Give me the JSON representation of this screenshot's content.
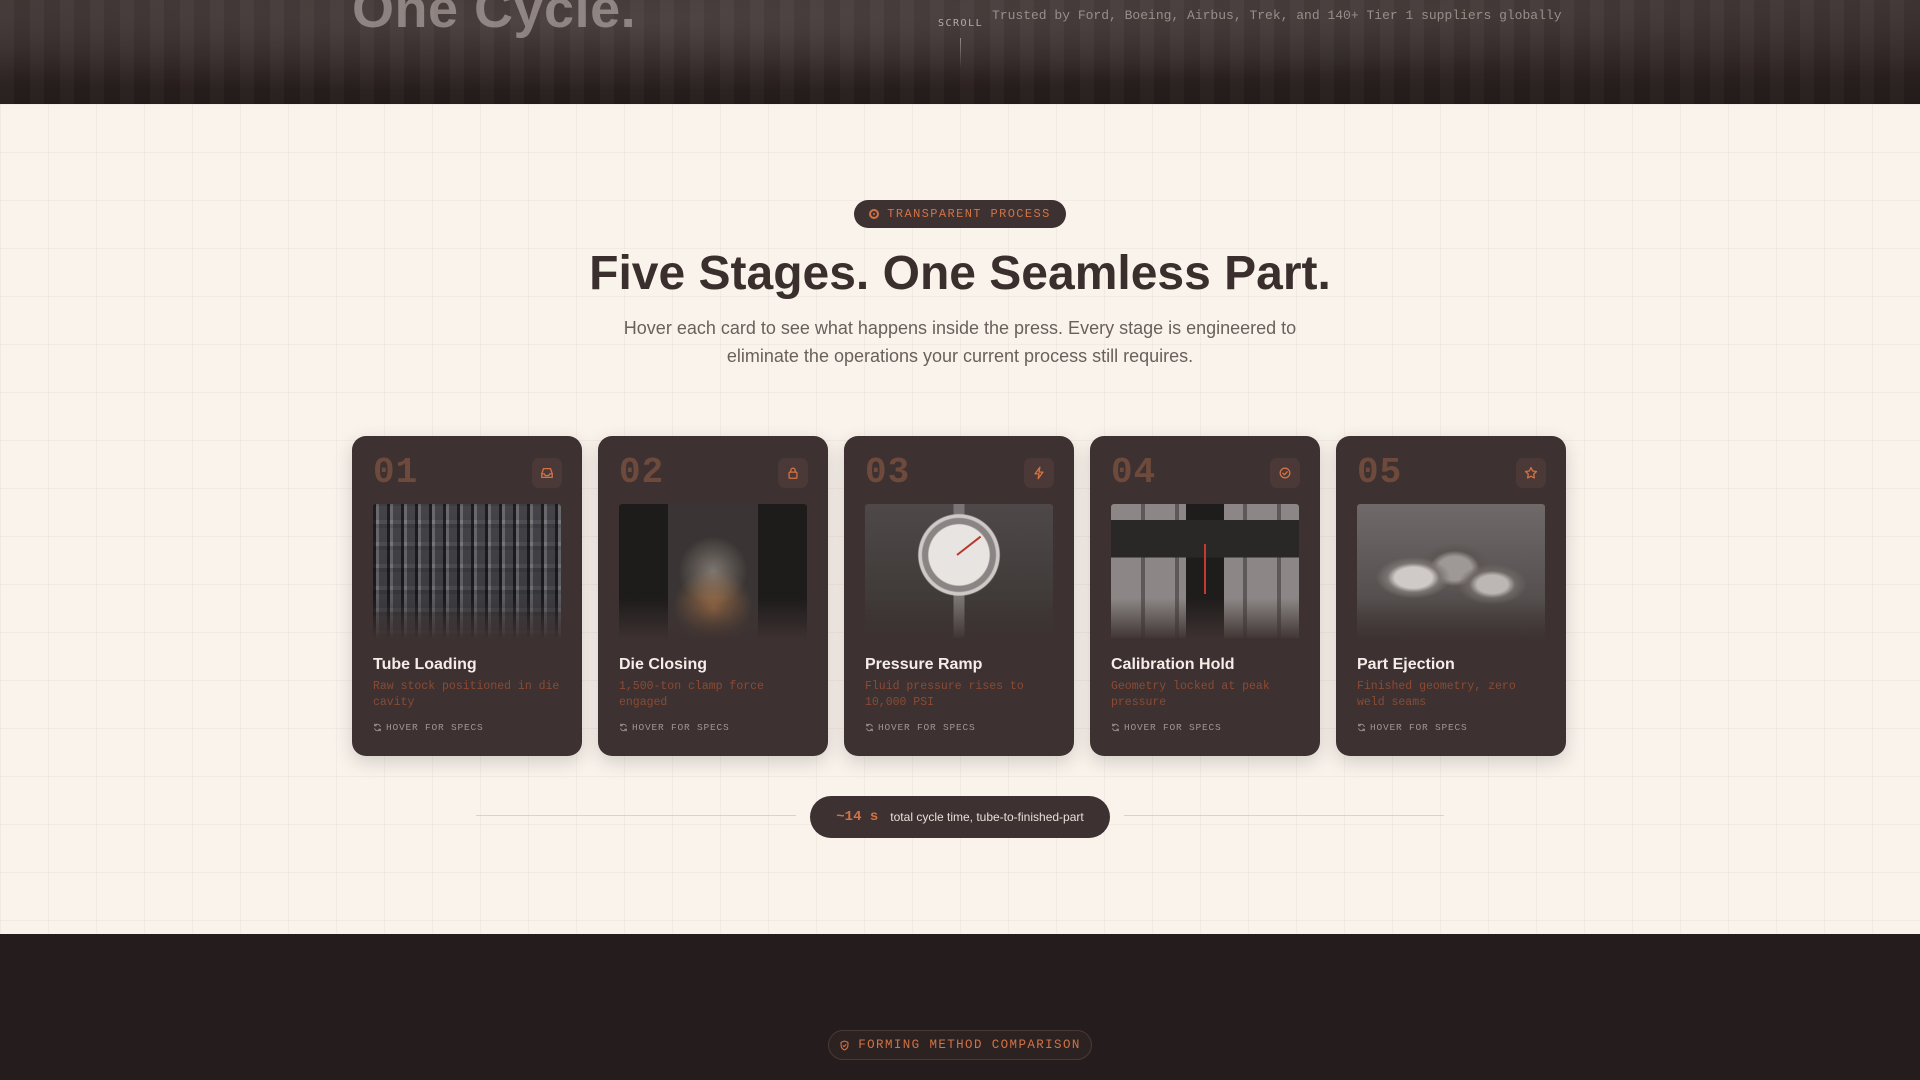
{
  "hero": {
    "title": "One Cycle.",
    "scroll_label": "SCROLL",
    "trusted_text": "Trusted by Ford, Boeing, Airbus, Trek, and 140+ Tier 1 suppliers globally"
  },
  "process": {
    "eyebrow": "TRANSPARENT PROCESS",
    "title": "Five Stages. One Seamless Part.",
    "subtitle": "Hover each card to see what happens inside the press. Every stage is engineered to eliminate the operations your current process still requires.",
    "cards": [
      {
        "number": "01",
        "icon": "inbox-tray-icon",
        "image": "warehouse-racks",
        "title": "Tube Loading",
        "description": "Raw stock positioned in die cavity",
        "hint": "HOVER FOR SPECS"
      },
      {
        "number": "02",
        "icon": "lock-icon",
        "image": "hydraulic-press",
        "title": "Die Closing",
        "description": "1,500-ton clamp force engaged",
        "hint": "HOVER FOR SPECS"
      },
      {
        "number": "03",
        "icon": "lightning-icon",
        "image": "pressure-gauge",
        "title": "Pressure Ramp",
        "description": "Fluid pressure rises to 10,000 PSI",
        "hint": "HOVER FOR SPECS"
      },
      {
        "number": "04",
        "icon": "check-circle-icon",
        "image": "cmm-probe",
        "title": "Calibration Hold",
        "description": "Geometry locked at peak pressure",
        "hint": "HOVER FOR SPECS"
      },
      {
        "number": "05",
        "icon": "star-icon",
        "image": "formed-tube-part",
        "title": "Part Ejection",
        "description": "Finished geometry, zero weld seams",
        "hint": "HOVER FOR SPECS"
      }
    ],
    "cycle": {
      "value": "~14 s",
      "label": "total cycle time, tube-to-finished-part"
    }
  },
  "compare": {
    "eyebrow": "FORMING METHOD COMPARISON"
  },
  "colors": {
    "accent": "#d27245",
    "card_bg": "#3d3231",
    "page_bg": "#faf3ec",
    "dark_bg": "#241c1d"
  }
}
